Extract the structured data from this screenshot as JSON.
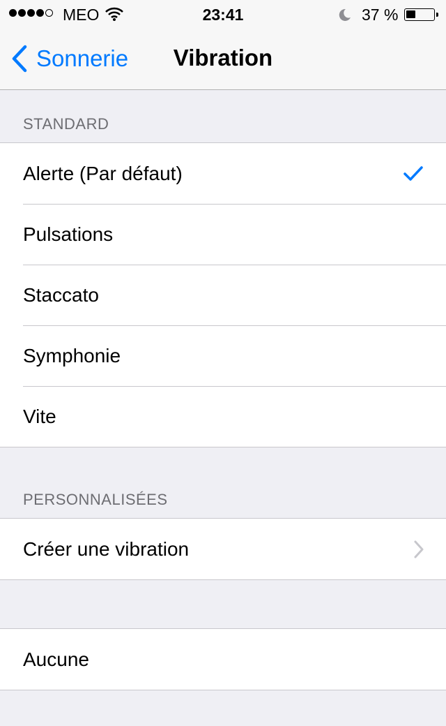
{
  "status_bar": {
    "carrier": "MEO",
    "time": "23:41",
    "battery_percent": "37 %",
    "battery_level": 0.37,
    "signal_bars_filled": 4,
    "signal_bars_total": 5
  },
  "nav": {
    "back_label": "Sonnerie",
    "title": "Vibration"
  },
  "sections": {
    "standard": {
      "header": "STANDARD",
      "items": [
        {
          "label": "Alerte (Par défaut)",
          "selected": true
        },
        {
          "label": "Pulsations",
          "selected": false
        },
        {
          "label": "Staccato",
          "selected": false
        },
        {
          "label": "Symphonie",
          "selected": false
        },
        {
          "label": "Vite",
          "selected": false
        }
      ]
    },
    "custom": {
      "header": "PERSONNALISÉES",
      "items": [
        {
          "label": "Créer une vibration"
        }
      ]
    },
    "none": {
      "items": [
        {
          "label": "Aucune"
        }
      ]
    }
  },
  "colors": {
    "accent": "#007aff",
    "background": "#efeff4",
    "separator": "#c8c7cc",
    "header_text": "#6d6d72",
    "chevron": "#c7c7cc"
  },
  "icons": [
    "signal-icon",
    "wifi-icon",
    "moon-icon",
    "battery-icon",
    "back-chevron-icon",
    "checkmark-icon",
    "chevron-right-icon"
  ]
}
